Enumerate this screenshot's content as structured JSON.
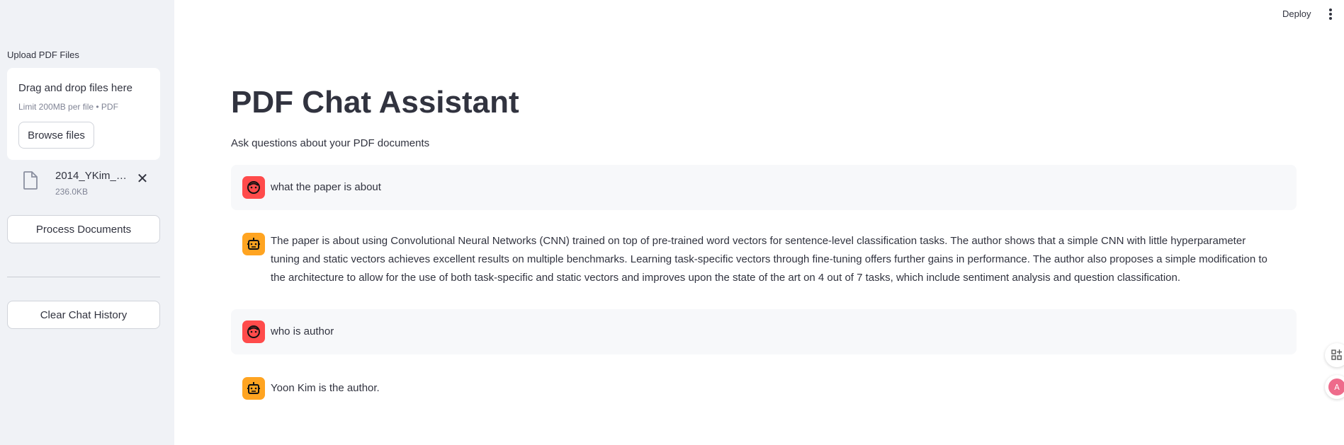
{
  "sidebar": {
    "upload_label": "Upload PDF Files",
    "dropzone": {
      "title": "Drag and drop files here",
      "subtitle": "Limit 200MB per file • PDF",
      "browse_label": "Browse files"
    },
    "file": {
      "name": "2014_YKim_C...",
      "size": "236.0KB"
    },
    "process_label": "Process Documents",
    "clear_label": "Clear Chat History"
  },
  "topbar": {
    "deploy_label": "Deploy"
  },
  "main": {
    "title": "PDF Chat Assistant",
    "subtitle": "Ask questions about your PDF documents",
    "messages": [
      {
        "role": "user",
        "text": "what the paper is about"
      },
      {
        "role": "assistant",
        "text": "The paper is about using Convolutional Neural Networks (CNN) trained on top of pre-trained word vectors for sentence-level classification tasks. The author shows that a simple CNN with little hyperparameter tuning and static vectors achieves excellent results on multiple benchmarks. Learning task-specific vectors through fine-tuning offers further gains in performance. The author also proposes a simple modification to the architecture to allow for the use of both task-specific and static vectors and improves upon the state of the art on 4 out of 7 tasks, which include sentiment analysis and question classification."
      },
      {
        "role": "user",
        "text": "who is author"
      },
      {
        "role": "assistant",
        "text": "Yoon Kim is the author."
      }
    ]
  },
  "colors": {
    "sidebar_bg": "#f0f2f6",
    "user_avatar": "#ff4b4b",
    "assistant_avatar": "#ffa421",
    "user_msg_bg": "#f7f8fa"
  },
  "icons": {
    "file": "file-icon",
    "close": "close-icon",
    "user_avatar": "user-face-icon",
    "assistant_avatar": "robot-icon",
    "menu": "vertical-dots-icon"
  }
}
